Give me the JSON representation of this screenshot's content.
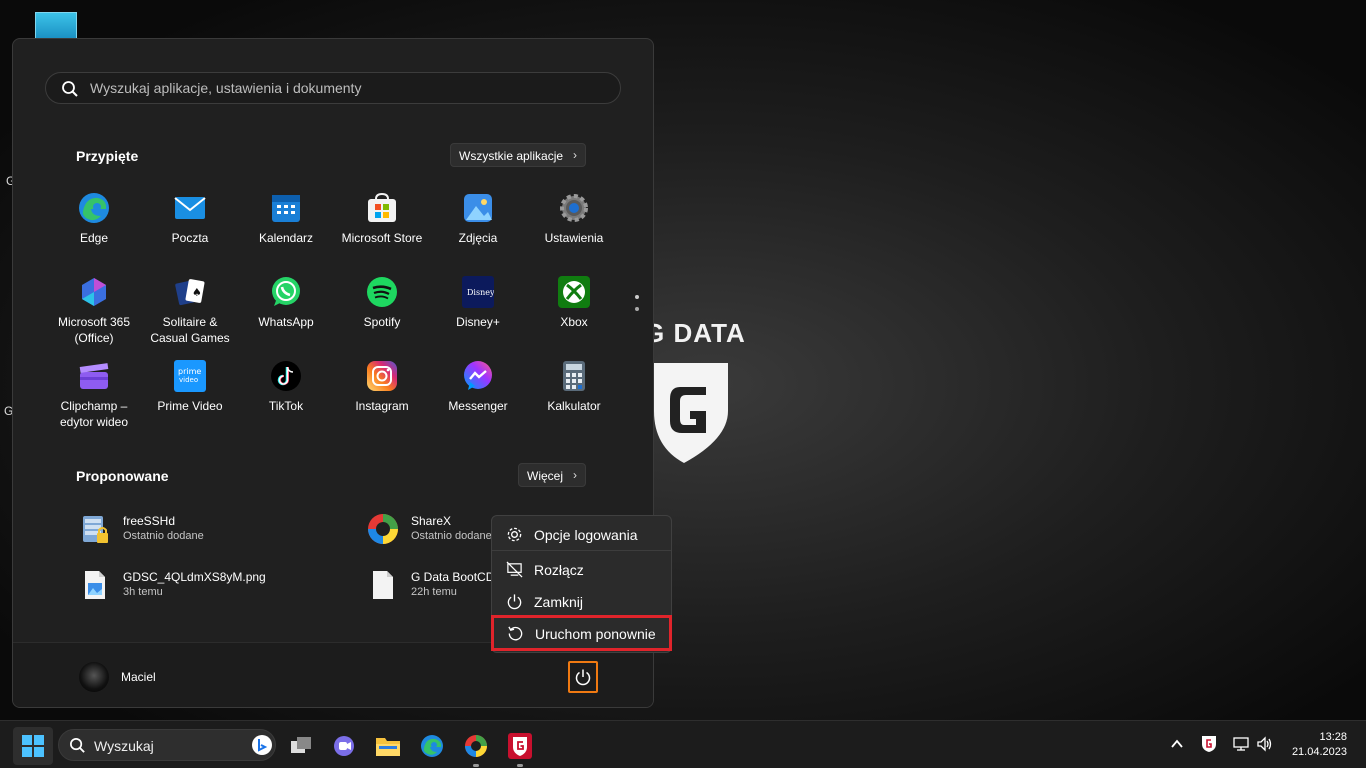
{
  "desktop": {
    "letters": [
      "G",
      "Gl"
    ]
  },
  "wallpaper": {
    "logo_text": "G DATA"
  },
  "start_menu": {
    "search": {
      "placeholder": "Wyszukaj aplikacje, ustawienia i dokumenty"
    },
    "pinned": {
      "title": "Przypięte",
      "all_apps_label": "Wszystkie aplikacje",
      "apps": [
        {
          "label": "Edge",
          "icon": "edge-icon"
        },
        {
          "label": "Poczta",
          "icon": "mail-icon"
        },
        {
          "label": "Kalendarz",
          "icon": "calendar-icon"
        },
        {
          "label": "Microsoft Store",
          "icon": "store-icon"
        },
        {
          "label": "Zdjęcia",
          "icon": "photos-icon"
        },
        {
          "label": "Ustawienia",
          "icon": "settings-icon"
        },
        {
          "label": "Microsoft 365 (Office)",
          "icon": "office-icon"
        },
        {
          "label": "Solitaire & Casual Games",
          "icon": "solitaire-icon"
        },
        {
          "label": "WhatsApp",
          "icon": "whatsapp-icon"
        },
        {
          "label": "Spotify",
          "icon": "spotify-icon"
        },
        {
          "label": "Disney+",
          "icon": "disney-icon"
        },
        {
          "label": "Xbox",
          "icon": "xbox-icon"
        },
        {
          "label": "Clipchamp – edytor wideo",
          "icon": "clipchamp-icon"
        },
        {
          "label": "Prime Video",
          "icon": "prime-video-icon"
        },
        {
          "label": "TikTok",
          "icon": "tiktok-icon"
        },
        {
          "label": "Instagram",
          "icon": "instagram-icon"
        },
        {
          "label": "Messenger",
          "icon": "messenger-icon"
        },
        {
          "label": "Kalkulator",
          "icon": "calculator-icon"
        }
      ]
    },
    "recommended": {
      "title": "Proponowane",
      "more_label": "Więcej",
      "items": [
        {
          "name": "freeSSHd",
          "sub": "Ostatnio dodane",
          "icon": "freesshd-icon"
        },
        {
          "name": "ShareX",
          "sub": "Ostatnio dodane",
          "icon": "sharex-icon"
        },
        {
          "name": "GDSC_4QLdmXS8yM.png",
          "sub": "3h temu",
          "icon": "image-file-icon"
        },
        {
          "name": "G Data BootCD",
          "sub": "22h temu",
          "icon": "file-icon"
        }
      ]
    },
    "user": {
      "name": "Maciel"
    }
  },
  "power_menu": {
    "items": [
      {
        "label": "Opcje logowania",
        "icon": "gear-icon"
      },
      {
        "label": "Rozłącz",
        "icon": "disconnect-icon"
      },
      {
        "label": "Zamknij",
        "icon": "power-icon"
      },
      {
        "label": "Uruchom ponownie",
        "icon": "restart-icon"
      }
    ],
    "highlight_color": "#e0242b"
  },
  "taskbar": {
    "search_label": "Wyszukaj",
    "apps": [
      "task-view-icon",
      "teams-chat-icon",
      "file-explorer-icon",
      "edge-icon",
      "sharex-icon",
      "gdata-icon"
    ],
    "clock": {
      "time": "13:28",
      "date": "21.04.2023"
    }
  },
  "colors": {
    "accent_orange": "#f07a12",
    "highlight_red": "#e0242b"
  }
}
